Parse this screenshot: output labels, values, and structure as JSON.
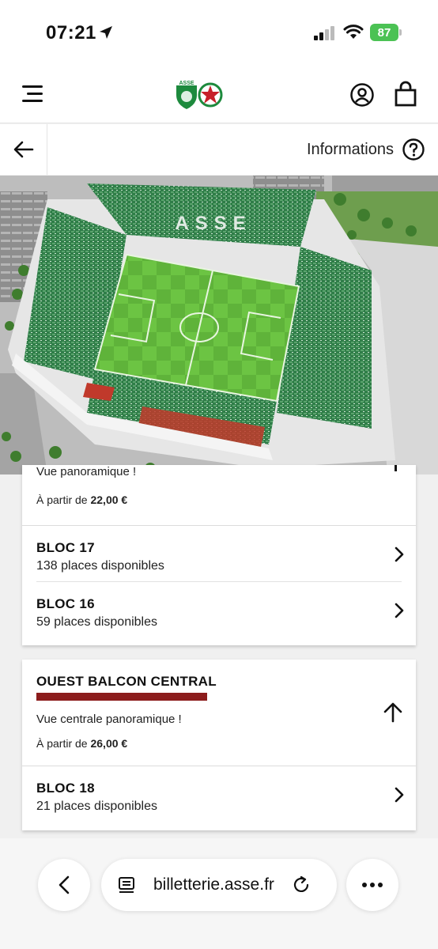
{
  "status": {
    "time": "07:21",
    "battery": "87"
  },
  "subheader": {
    "info_label": "Informations"
  },
  "stadium": {
    "stand_letters": "ASSE"
  },
  "sections": [
    {
      "description": "Vue panoramique !",
      "price_prefix": "À partir de",
      "price": "22,00 €",
      "blocs": [
        {
          "name": "BLOC 17",
          "availability": "138 places disponibles"
        },
        {
          "name": "BLOC 16",
          "availability": "59 places disponibles"
        }
      ]
    },
    {
      "title": "OUEST BALCON CENTRAL",
      "description": "Vue centrale panoramique !",
      "price_prefix": "À partir de",
      "price": "26,00 €",
      "accent_color": "#8c1c1c",
      "blocs": [
        {
          "name": "BLOC 18",
          "availability": "21 places disponibles"
        }
      ]
    }
  ],
  "browser": {
    "url": "billetterie.asse.fr"
  },
  "icons": {
    "location": "location-arrow-icon",
    "signal": "signal-icon",
    "wifi": "wifi-icon",
    "menu": "menu-icon",
    "account": "account-icon",
    "cart": "cart-icon",
    "back": "arrow-left-icon",
    "info": "question-circle-icon",
    "chevron": "chevron-right-icon",
    "collapse": "arrow-up-icon"
  }
}
